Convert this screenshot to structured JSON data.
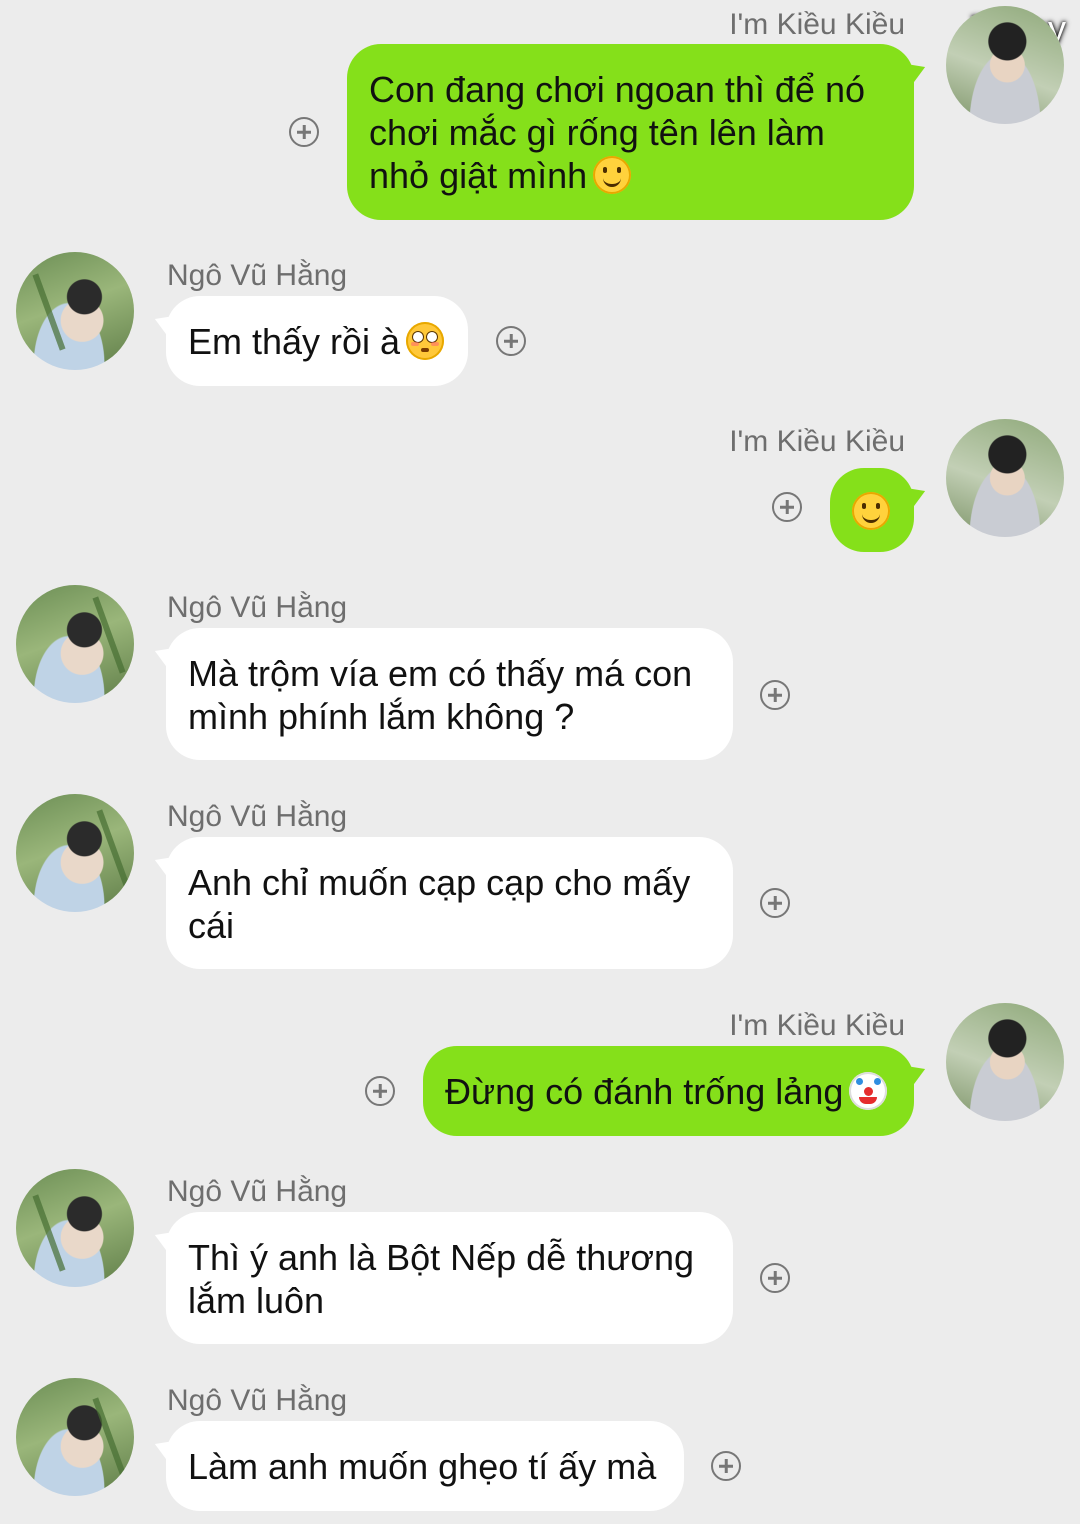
{
  "overlay_label": "74 joy",
  "messages": [
    {
      "sender": "I'm Kiều Kiều",
      "side": "out",
      "text": "Con đang chơi ngoan thì để nó chơi mắc gì rống tên lên làm nhỏ giật mình",
      "emoji": "slightly-smiling-face"
    },
    {
      "sender": "Ngô Vũ Hằng",
      "side": "in",
      "text": "Em thấy rồi à",
      "emoji": "flushed-face"
    },
    {
      "sender": "I'm Kiều Kiều",
      "side": "out",
      "text": "",
      "emoji": "slightly-smiling-face"
    },
    {
      "sender": "Ngô Vũ Hằng",
      "side": "in",
      "text": "Mà trộm vía em có thấy má con mình phính lắm không ?"
    },
    {
      "sender": "Ngô Vũ Hằng",
      "side": "in",
      "text": "Anh chỉ muốn cạp cạp cho mấy cái"
    },
    {
      "sender": "I'm Kiều Kiều",
      "side": "out",
      "text": "Đừng có đánh trống lảng",
      "emoji": "clown-face"
    },
    {
      "sender": "Ngô Vũ Hằng",
      "side": "in",
      "text": "Thì ý anh là Bột Nếp dễ thương lắm luôn"
    },
    {
      "sender": "Ngô Vũ Hằng",
      "side": "in",
      "text": "Làm anh muốn ghẹo tí ấy mà"
    }
  ],
  "colors": {
    "background": "#ececec",
    "outgoing_bubble": "#85e01a",
    "incoming_bubble": "#ffffff",
    "name_text": "#6e6e6e"
  },
  "icons": {
    "add_reaction": "add-reaction-icon"
  }
}
